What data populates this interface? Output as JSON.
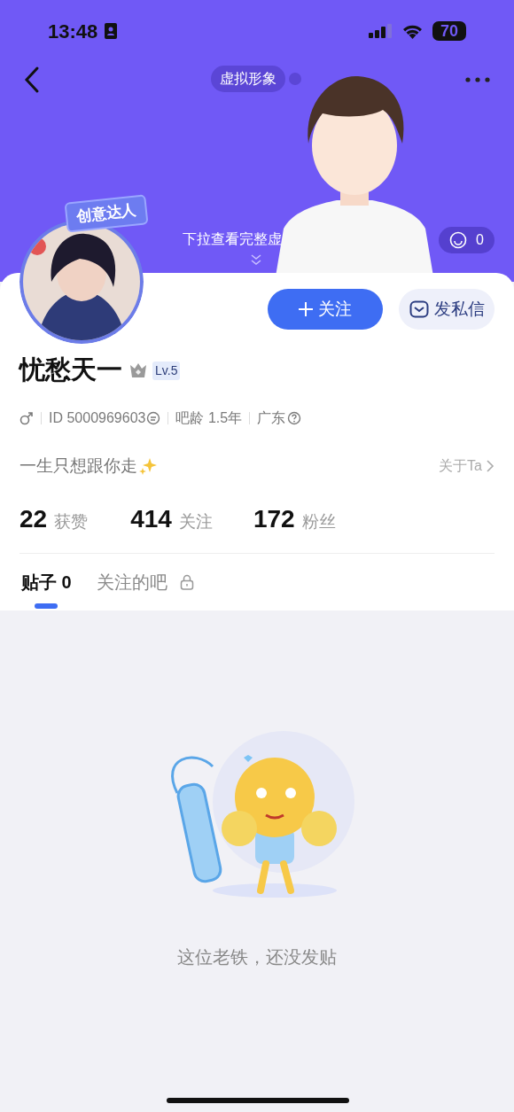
{
  "status_bar": {
    "time": "13:48",
    "battery": "70"
  },
  "header": {
    "title_chip": "虚拟形象",
    "hint": "下拉查看完整虚",
    "likes": "0"
  },
  "avatar_badge": "创意达人",
  "actions": [
    {
      "kind": "follow",
      "label": "关注"
    },
    {
      "kind": "message",
      "label": "发私信"
    }
  ],
  "profile": {
    "name": "忧愁天一",
    "level": "Lv.5",
    "id": "ID 5000969603",
    "age": "吧龄 1.5年",
    "location": "广东",
    "bio": "一生只想跟你走",
    "about": "关于Ta"
  },
  "stats": [
    {
      "value": "22",
      "label": "获赞"
    },
    {
      "value": "414",
      "label": "关注"
    },
    {
      "value": "172",
      "label": "粉丝"
    }
  ],
  "tabs": [
    {
      "label": "贴子",
      "count": "0",
      "locked": false,
      "selected": true
    },
    {
      "label": "关注的吧",
      "locked": true,
      "selected": false
    }
  ],
  "empty_state": {
    "message": "这位老铁，还没发贴"
  }
}
